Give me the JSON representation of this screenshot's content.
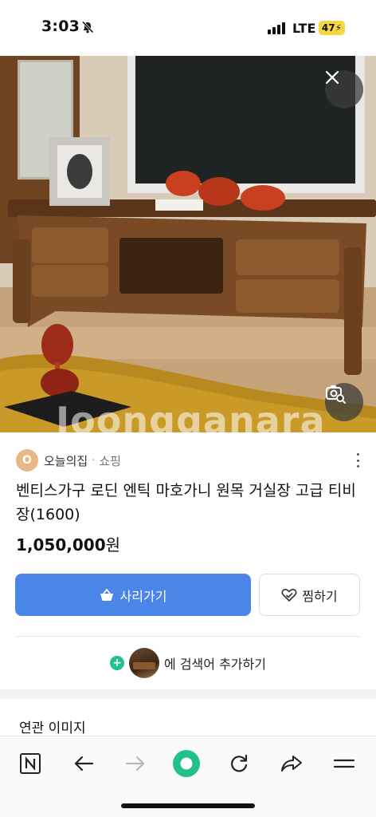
{
  "status_bar": {
    "time": "3:03",
    "network": "LTE",
    "battery": "47"
  },
  "hero": {
    "watermark": "Joongganara",
    "icons": [
      "close-icon",
      "image-search-icon"
    ]
  },
  "source": {
    "avatar_letter": "O",
    "name": "오늘의집",
    "separator": "·",
    "category": "쇼핑"
  },
  "product": {
    "title": "벤티스가구 로딘 엔틱 마호가니 원목 거실장 고급 티비장(1600)",
    "price": "1,050,000",
    "currency": "원"
  },
  "actions": {
    "buy_label": "사리가기",
    "wish_label": "찜하기"
  },
  "add_search": {
    "label": "에 검색어 추가하기"
  },
  "related": {
    "title": "연관 이미지"
  },
  "toolbar": {
    "items": [
      "naver-n-icon",
      "back-arrow-icon",
      "forward-arrow-icon",
      "home-green-icon",
      "refresh-icon",
      "share-icon",
      "menu-icon"
    ]
  },
  "colors": {
    "primary_blue": "#4a86e8",
    "green": "#22c08b",
    "battery_yellow": "#f6d740"
  }
}
